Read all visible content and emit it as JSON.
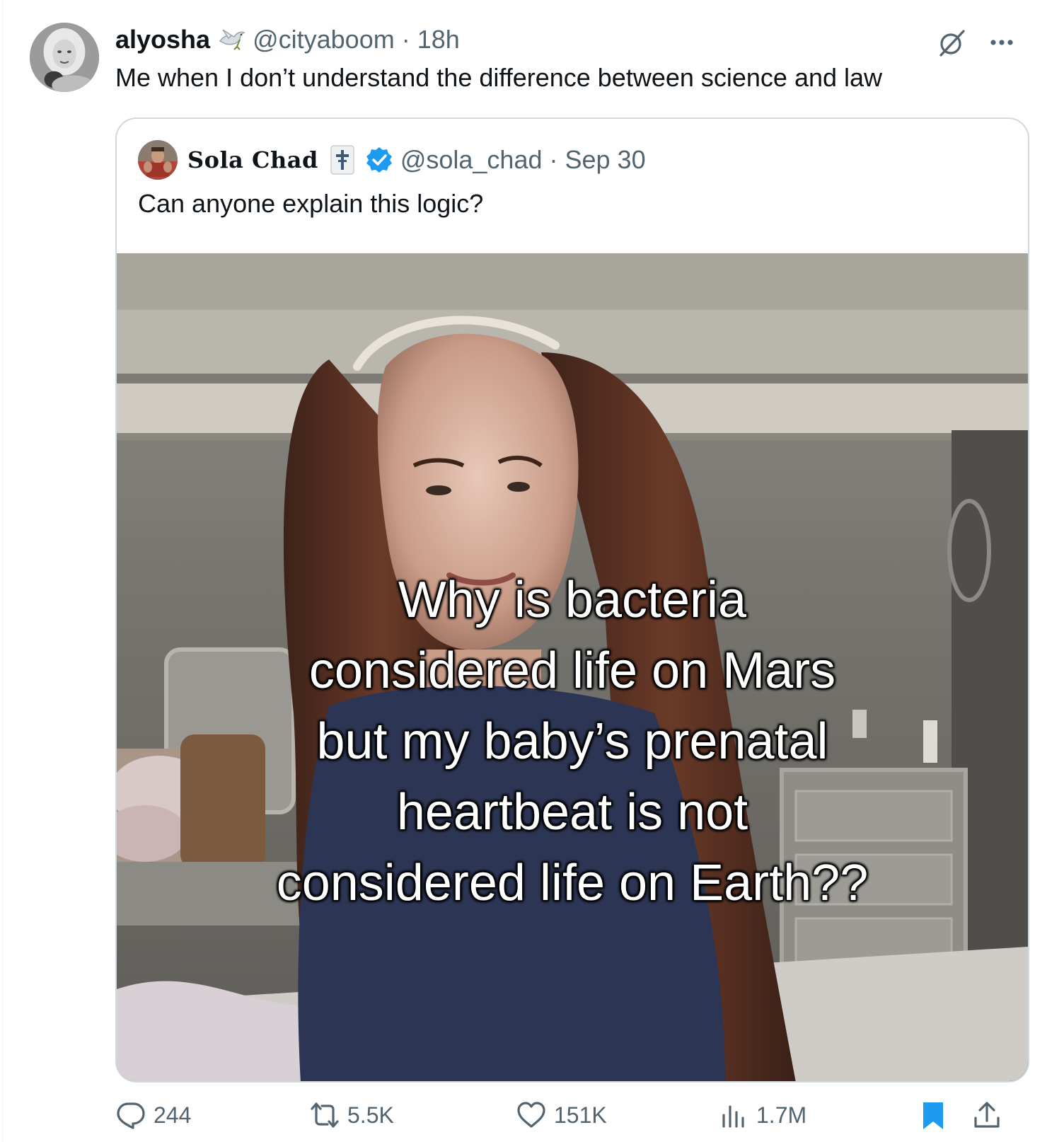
{
  "tweet": {
    "display_name": "alyosha",
    "handle": "@cityaboom",
    "separator": "·",
    "time": "18h",
    "text": "Me when I don’t understand the difference between science and law",
    "name_emoji_icon": "dove-icon"
  },
  "quoted_tweet": {
    "display_name": "Sola Chad",
    "handle": "@sola_chad",
    "separator": "·",
    "date": "Sep 30",
    "text": "Can anyone explain this logic?",
    "verified": true,
    "name_emoji_icon": "cross-badge-icon",
    "media": {
      "caption_lines": [
        "Why is bacteria",
        "considered life on Mars",
        "but my baby’s prenatal",
        "heartbeat is not",
        "considered life on Earth??"
      ]
    }
  },
  "actions": {
    "replies": "244",
    "reposts": "5.5K",
    "likes": "151K",
    "views": "1.7M",
    "bookmark_icon": "bookmark-icon",
    "share_icon": "share-icon"
  },
  "colors": {
    "text_primary": "#0f1419",
    "text_secondary": "#536471",
    "border": "#cfd9de",
    "verified_blue": "#1d9bf0",
    "bookmark_blue": "#1d9bf0"
  }
}
